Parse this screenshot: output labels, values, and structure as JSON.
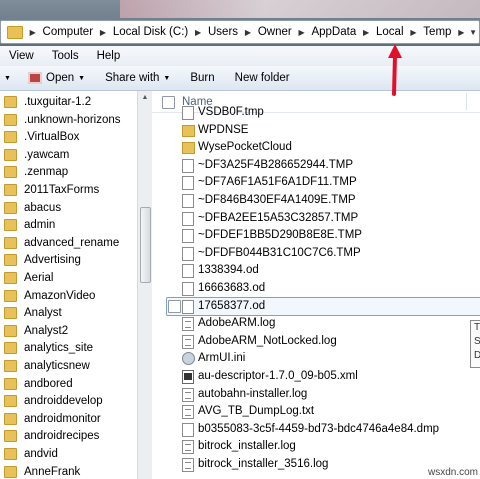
{
  "address": {
    "crumbs": [
      "Computer",
      "Local Disk (C:)",
      "Users",
      "Owner",
      "AppData",
      "Local",
      "Temp"
    ]
  },
  "menu": [
    "View",
    "Tools",
    "Help"
  ],
  "toolbar": {
    "open": "Open",
    "share_with": "Share with",
    "burn": "Burn",
    "new_folder": "New folder"
  },
  "nav": {
    "items": [
      ".tuxguitar-1.2",
      ".unknown-horizons",
      ".VirtualBox",
      ".yawcam",
      ".zenmap",
      "2011TaxForms",
      "abacus",
      "admin",
      "advanced_rename",
      "Advertising",
      "Aerial",
      "AmazonVideo",
      "Analyst",
      "Analyst2",
      "analytics_site",
      "analyticsnew",
      "andbored",
      "androiddevelop",
      "androidmonitor",
      "androidrecipes",
      "andvid",
      "AnneFrank"
    ]
  },
  "list": {
    "column_name": "Name",
    "items": [
      {
        "name": "VSDB0F.tmp",
        "type": "file"
      },
      {
        "name": "WPDNSE",
        "type": "folder"
      },
      {
        "name": "WysePocketCloud",
        "type": "folder"
      },
      {
        "name": "~DF3A25F4B286652944.TMP",
        "type": "file"
      },
      {
        "name": "~DF7A6F1A51F6A1DF11.TMP",
        "type": "file"
      },
      {
        "name": "~DF846B430EF4A1409E.TMP",
        "type": "file"
      },
      {
        "name": "~DFBA2EE15A53C32857.TMP",
        "type": "file"
      },
      {
        "name": "~DFDEF1BB5D290B8E8E.TMP",
        "type": "file"
      },
      {
        "name": "~DFDFB044B31C10C7C6.TMP",
        "type": "file"
      },
      {
        "name": "1338394.od",
        "type": "file"
      },
      {
        "name": "16663683.od",
        "type": "file"
      },
      {
        "name": "17658377.od",
        "type": "file",
        "selected": true
      },
      {
        "name": "AdobeARM.log",
        "type": "log"
      },
      {
        "name": "AdobeARM_NotLocked.log",
        "type": "log"
      },
      {
        "name": "ArmUI.ini",
        "type": "ini"
      },
      {
        "name": "au-descriptor-1.7.0_09-b05.xml",
        "type": "xml"
      },
      {
        "name": "autobahn-installer.log",
        "type": "log"
      },
      {
        "name": "AVG_TB_DumpLog.txt",
        "type": "log"
      },
      {
        "name": "b0355083-3c5f-4459-bd73-bdc4746a4e84.dmp",
        "type": "file"
      },
      {
        "name": "bitrock_installer.log",
        "type": "log"
      },
      {
        "name": "bitrock_installer_3516.log",
        "type": "log"
      }
    ]
  },
  "tooltip": {
    "lines": [
      "T",
      "S",
      "D"
    ]
  },
  "footer": "wsxdn.com",
  "colors": {
    "arrow": "#e0102a",
    "folder": "#e7c25a"
  }
}
